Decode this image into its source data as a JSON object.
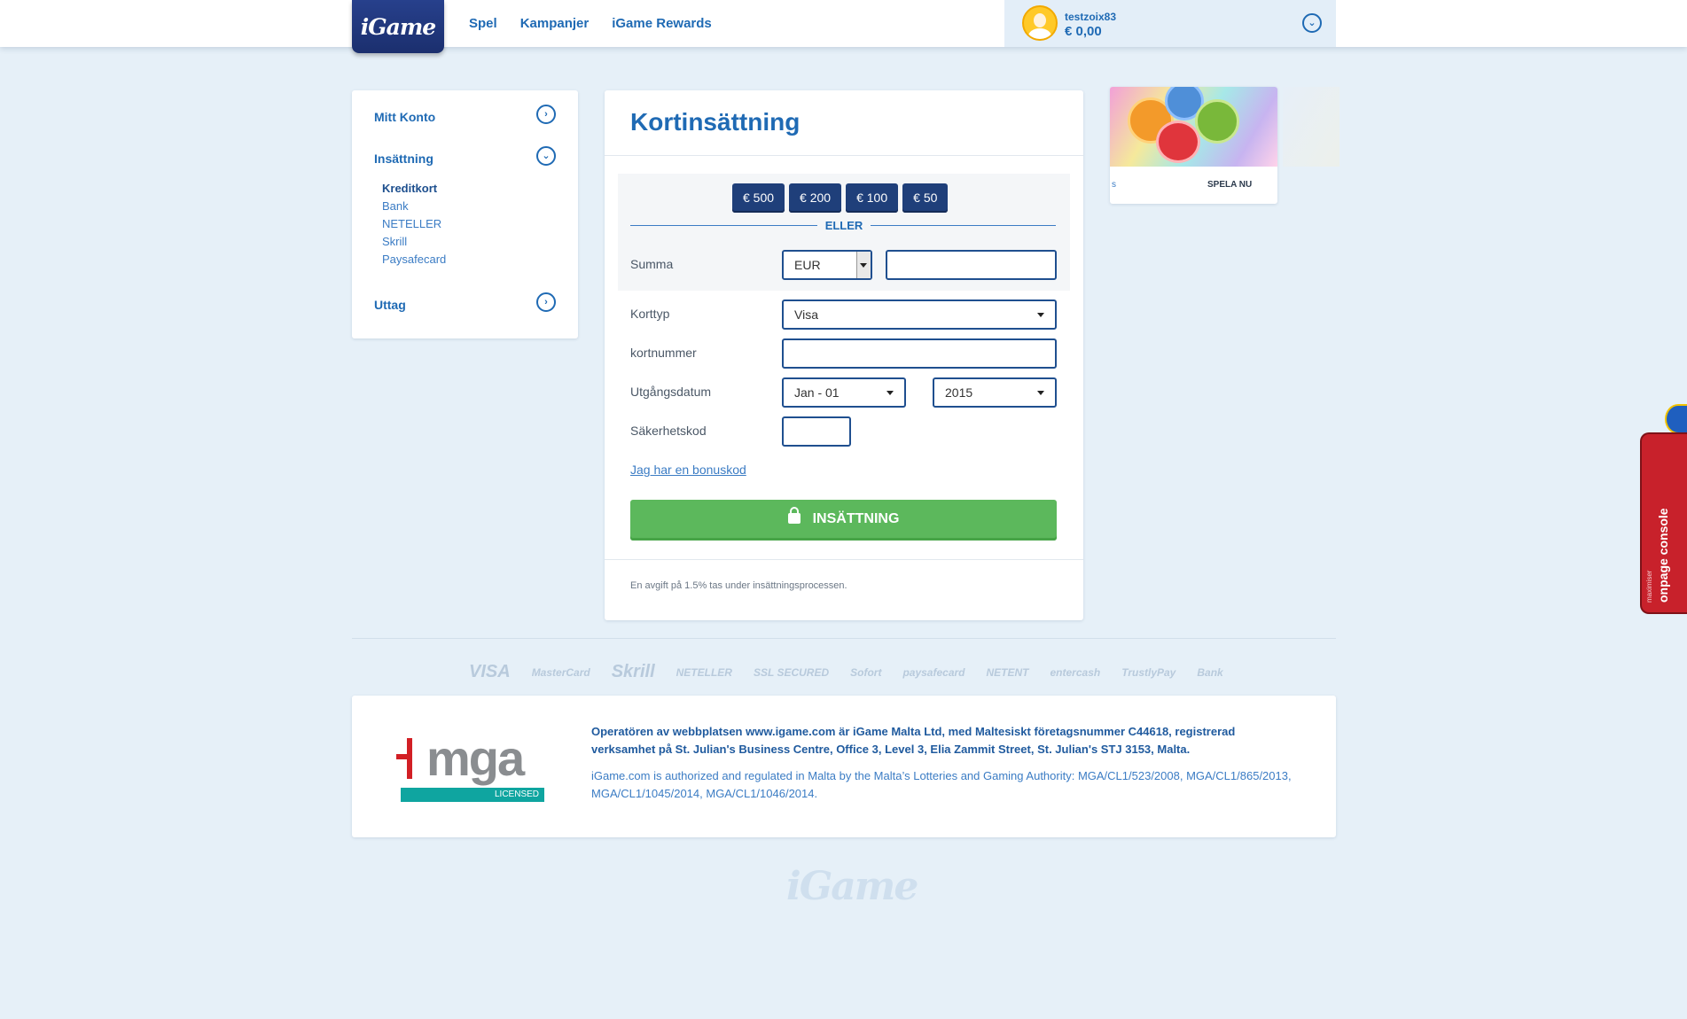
{
  "header": {
    "logo_text": "iGame",
    "nav": [
      "Spel",
      "Kampanjer",
      "iGame Rewards"
    ],
    "username": "testzoix83",
    "balance": "€ 0,00"
  },
  "sidebar": {
    "account": "Mitt Konto",
    "deposit": "Insättning",
    "deposit_methods": [
      "Kreditkort",
      "Bank",
      "NETELLER",
      "Skrill",
      "Paysafecard"
    ],
    "withdraw": "Uttag"
  },
  "form": {
    "title": "Kortinsättning",
    "quick_amounts": [
      "€ 500",
      "€ 200",
      "€ 100",
      "€ 50"
    ],
    "or_label": "ELLER",
    "amount_label": "Summa",
    "currency": "EUR",
    "amount_value": "",
    "card_type_label": "Korttyp",
    "card_type": "Visa",
    "card_number_label": "kortnummer",
    "card_number": "",
    "expiry_label": "Utgångsdatum",
    "expiry_month": "Jan - 01",
    "expiry_year": "2015",
    "cvc_label": "Säkerhetskod",
    "cvc": "",
    "bonus_link": "Jag har en bonuskod",
    "submit": "INSÄTTNING",
    "fee_note": "En avgift på 1.5% tas under insättningsprocessen."
  },
  "promo": {
    "cta": "SPELA NU",
    "title_fragment": "s"
  },
  "console": {
    "title": "onpage console",
    "brand": "maximiser"
  },
  "payment_logos": [
    "VISA",
    "MasterCard",
    "Skrill",
    "NETELLER",
    "SSL SECURED",
    "Sofort",
    "paysafecard",
    "NETENT",
    "entercash",
    "TrustlyPay",
    "Bank"
  ],
  "license": {
    "mga_text": "mga",
    "licensed": "LICENSED",
    "operator_text": "Operatören av webbplatsen www.igame.com är iGame Malta Ltd, med Maltesiskt företagsnummer C44618, registrerad verksamhet på St. Julian's Business Centre, Office 3, Level 3, Elia Zammit Street, St. Julian's STJ 3153, Malta.",
    "authority_text": "iGame.com is authorized and regulated in Malta by the Malta’s Lotteries and Gaming Authority: MGA/CL1/523/2008, MGA/CL1/865/2013, MGA/CL1/1045/2014, MGA/CL1/1046/2014."
  },
  "footer": {
    "logo_text": "iGame"
  },
  "colors": {
    "brand_blue": "#1f6ab4",
    "navy": "#1f3f7a",
    "green": "#5cb85c",
    "background": "#e6f0f8",
    "console_red": "#c8212b"
  }
}
